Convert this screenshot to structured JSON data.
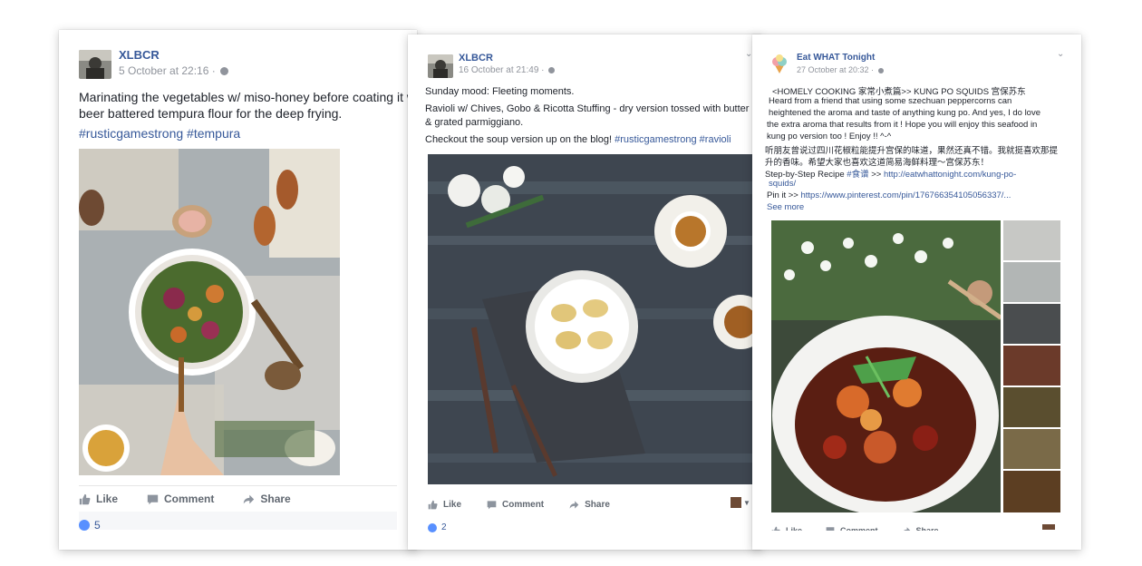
{
  "post1": {
    "author": "XLBCR",
    "timestamp": "5 October at 22:16 ·",
    "line1": "Marinating the vegetables w/ miso-honey before coating it w",
    "line2": "beer battered tempura flour for the deep frying.",
    "hashtags": "#rusticgamestrong #tempura",
    "like_label": "Like",
    "comment_label": "Comment",
    "share_label": "Share",
    "like_count": "5"
  },
  "post2": {
    "author": "XLBCR",
    "timestamp": "16 October at 21:49 ·",
    "line1": "Sunday mood: Fleeting moments.",
    "line2": "Ravioli w/ Chives, Gobo & Ricotta Stuffing - dry version tossed with butter",
    "line3": "& grated parmiggiano.",
    "line4_prefix": "Checkout the soup version up on the blog! ",
    "line4_tags": "#rusticgamestrong #ravioli",
    "like_label": "Like",
    "comment_label": "Comment",
    "share_label": "Share",
    "like_count": "2"
  },
  "post3": {
    "author": "Eat WHAT Tonight",
    "timestamp": "27 October at 20:32 ·",
    "line1": "<HOMELY COOKING 家常小煮篇>> KUNG PO SQUIDS 宫保苏东",
    "line2": "Heard from a friend that using some szechuan peppercorns can",
    "line3": "heightened the aroma and taste of anything kung po. And yes, I do love",
    "line4": "the extra aroma that results from it ! Hope you will enjoy this seafood in",
    "line5": "kung po version too ! Enjoy !! ^-^",
    "line6": "听朋友曾说过四川花椒粒能提升宫保的味道，果然还真不错。我就挺喜欢那提",
    "line7": "升的香味。希望大家也喜欢这道简易海鲜料理～宫保苏东！",
    "line8_prefix": "Step-by-Step Recipe ",
    "line8_tag": "#食谱",
    "line8_sep": " >> ",
    "line8_link": "http://eatwhattonight.com/kung-po-",
    "line9_link": "squids/",
    "line10_prefix": "Pin it >> ",
    "line10_link": "https://www.pinterest.com/pin/176766354105056337/...",
    "see_more": "See more",
    "like_label": "Like",
    "comment_label": "Comment",
    "share_label": "Share"
  },
  "colors": {
    "link": "#365899",
    "meta": "#90949c",
    "action": "#606770",
    "like_badge": "#5890ff"
  }
}
